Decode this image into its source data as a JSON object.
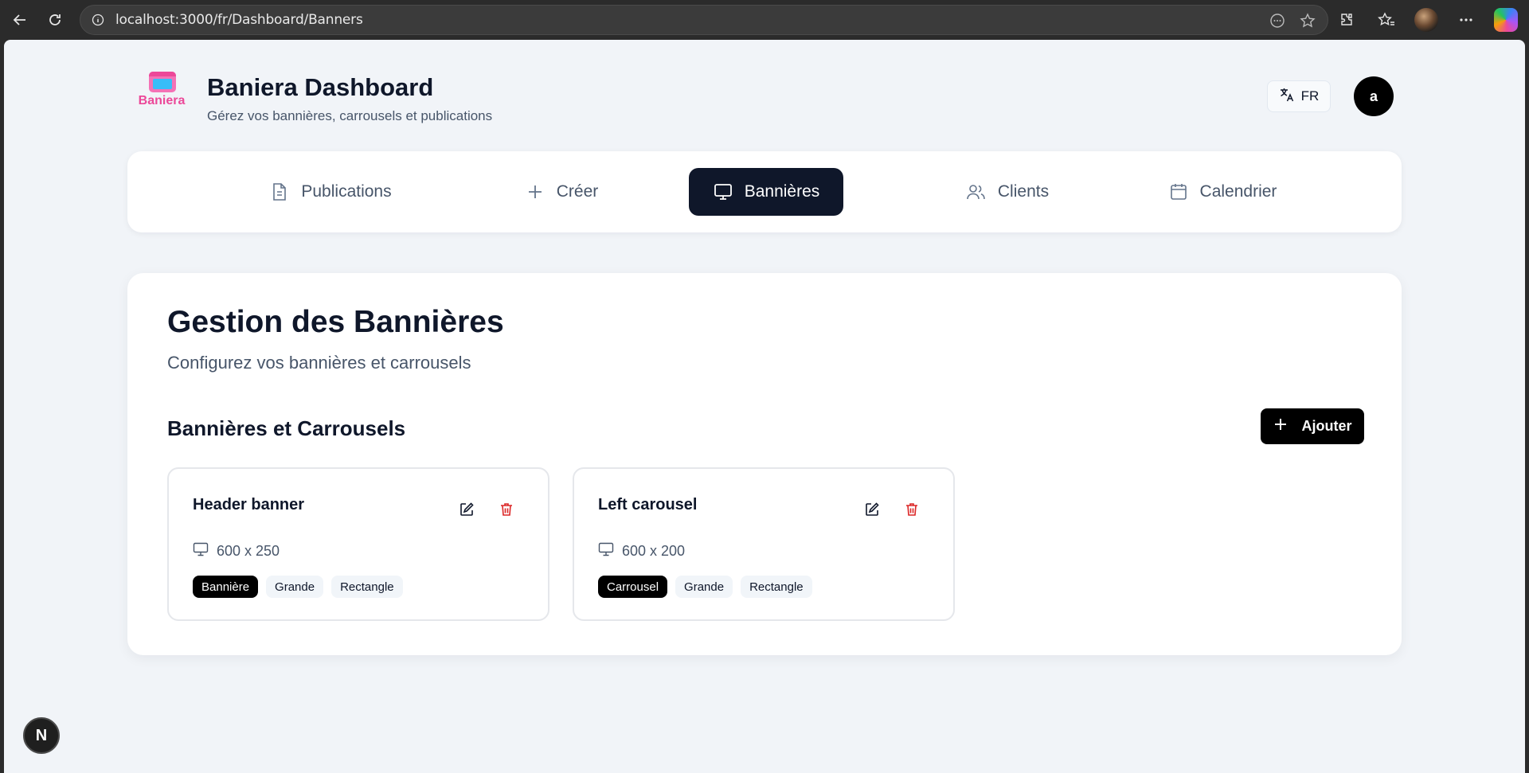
{
  "browser": {
    "url": "localhost:3000/fr/Dashboard/Banners"
  },
  "header": {
    "logo_text": "Baniera",
    "title": "Baniera Dashboard",
    "subtitle": "Gérez vos bannières, carrousels et publications",
    "language": "FR",
    "avatar_letter": "a"
  },
  "nav": {
    "tabs": [
      {
        "label": "Publications",
        "icon": "document-icon",
        "active": false
      },
      {
        "label": "Créer",
        "icon": "plus-icon",
        "active": false
      },
      {
        "label": "Bannières",
        "icon": "monitor-icon",
        "active": true
      },
      {
        "label": "Clients",
        "icon": "users-icon",
        "active": false
      },
      {
        "label": "Calendrier",
        "icon": "calendar-icon",
        "active": false
      }
    ]
  },
  "main": {
    "title": "Gestion des Bannières",
    "subtitle": "Configurez vos bannières et carrousels",
    "section_title": "Bannières et Carrousels",
    "add_label": "Ajouter",
    "cards": [
      {
        "title": "Header banner",
        "dimensions": "600 x 250",
        "tags": [
          "Bannière",
          "Grande",
          "Rectangle"
        ]
      },
      {
        "title": "Left carousel",
        "dimensions": "600 x 200",
        "tags": [
          "Carrousel",
          "Grande",
          "Rectangle"
        ]
      }
    ]
  },
  "dev_badge": "N",
  "colors": {
    "primary": "#0f172a",
    "brand": "#ec4899",
    "danger": "#dc2626",
    "background": "#f1f4f8"
  }
}
